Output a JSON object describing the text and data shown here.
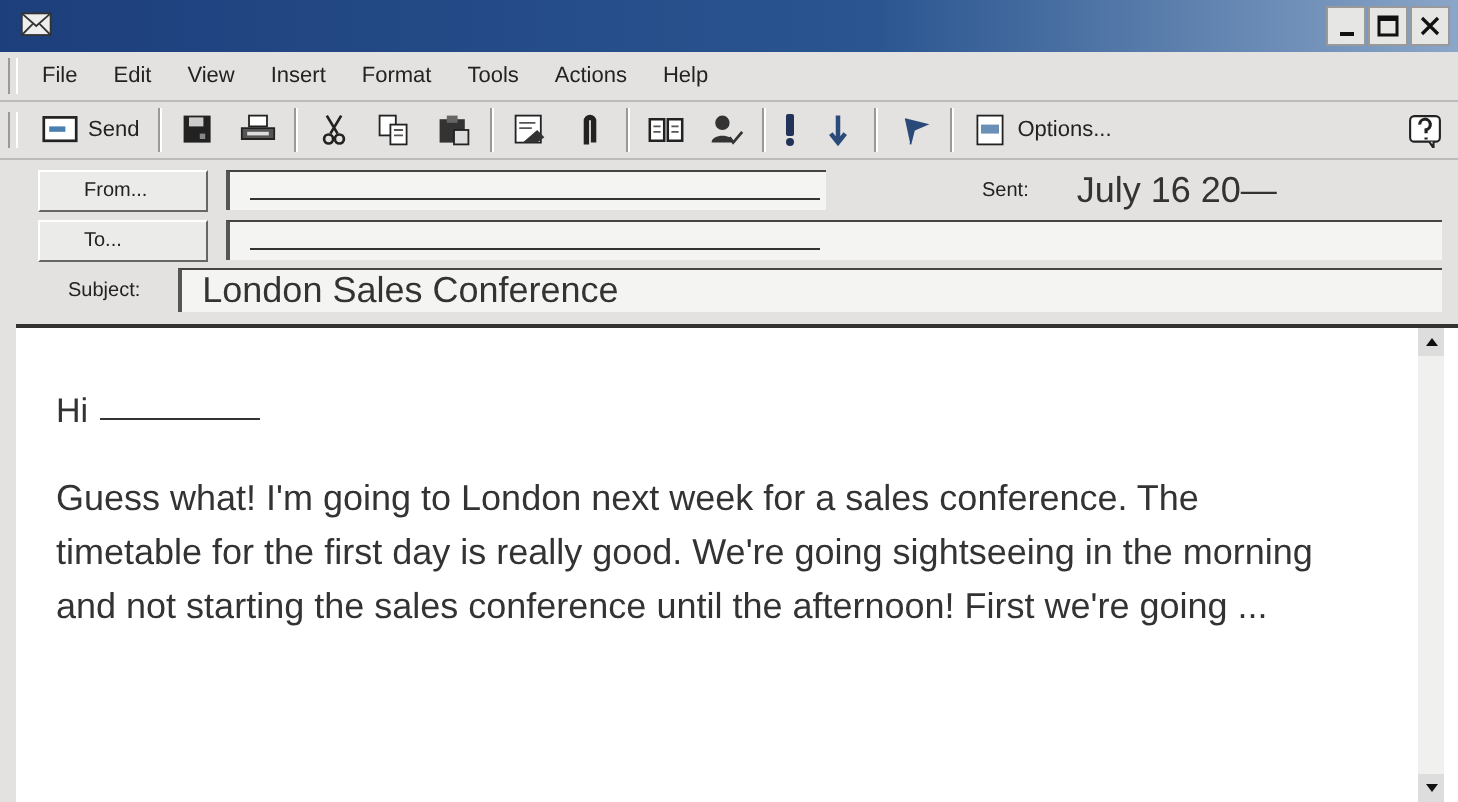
{
  "menu": [
    "File",
    "Edit",
    "View",
    "Insert",
    "Format",
    "Tools",
    "Actions",
    "Help"
  ],
  "toolbar": [
    {
      "kind": "button",
      "label": "Send"
    },
    {
      "kind": "sep"
    },
    {
      "kind": "button"
    },
    {
      "kind": "button"
    },
    {
      "kind": "sep"
    },
    {
      "kind": "button"
    },
    {
      "kind": "button"
    },
    {
      "kind": "button"
    },
    {
      "kind": "sep"
    },
    {
      "kind": "button"
    },
    {
      "kind": "button"
    },
    {
      "kind": "sep"
    },
    {
      "kind": "button"
    },
    {
      "kind": "button"
    },
    {
      "kind": "sep"
    },
    {
      "kind": "button"
    },
    {
      "kind": "button"
    },
    {
      "kind": "sep"
    },
    {
      "kind": "button"
    },
    {
      "kind": "sep"
    },
    {
      "kind": "button",
      "label": "Options..."
    },
    {
      "kind": "help"
    }
  ],
  "header": {
    "from_button": "From...",
    "to_button": "To...",
    "sent_label": "Sent:",
    "sent_value": "July 16 20—",
    "subject_label": "Subject:",
    "subject_value": "London Sales Conference"
  },
  "body": {
    "greeting": "Hi",
    "paragraph": "Guess what! I'm going to London next week for a sales conference. The timetable for the first day is really good. We're going sightseeing in the morning and not starting the sales conference until the afternoon! First we're going ..."
  }
}
